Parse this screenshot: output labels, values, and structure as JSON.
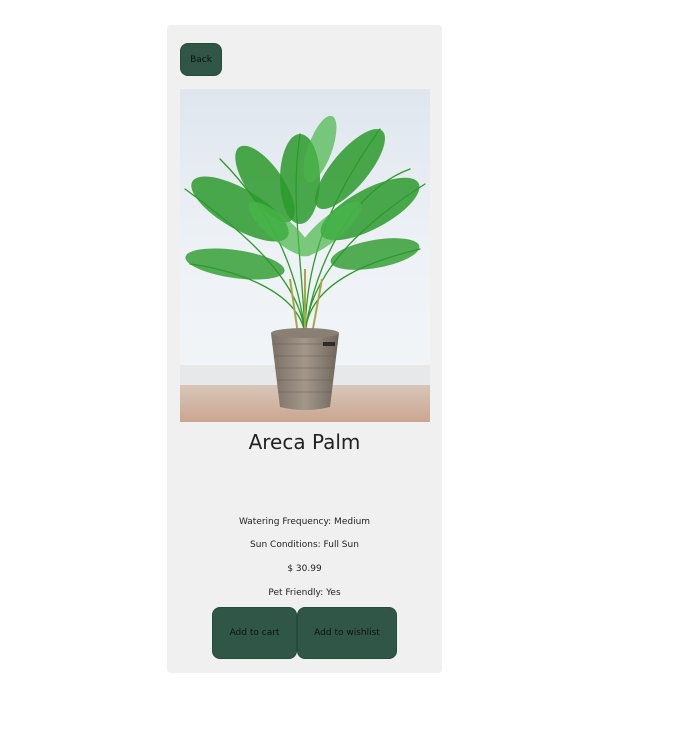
{
  "nav": {
    "back_label": "Back"
  },
  "product": {
    "name": "Areca Palm",
    "image_alt": "Areca Palm in woven basket",
    "watering": "Watering Frequency: Medium",
    "sun": "Sun Conditions: Full Sun",
    "price": "$ 30.99",
    "pet_friendly": "Pet Friendly: Yes"
  },
  "actions": {
    "add_to_cart": "Add to cart",
    "add_to_wishlist": "Add to wishlist"
  },
  "colors": {
    "button_bg": "#2f5647",
    "card_bg": "#f0f0f0"
  }
}
